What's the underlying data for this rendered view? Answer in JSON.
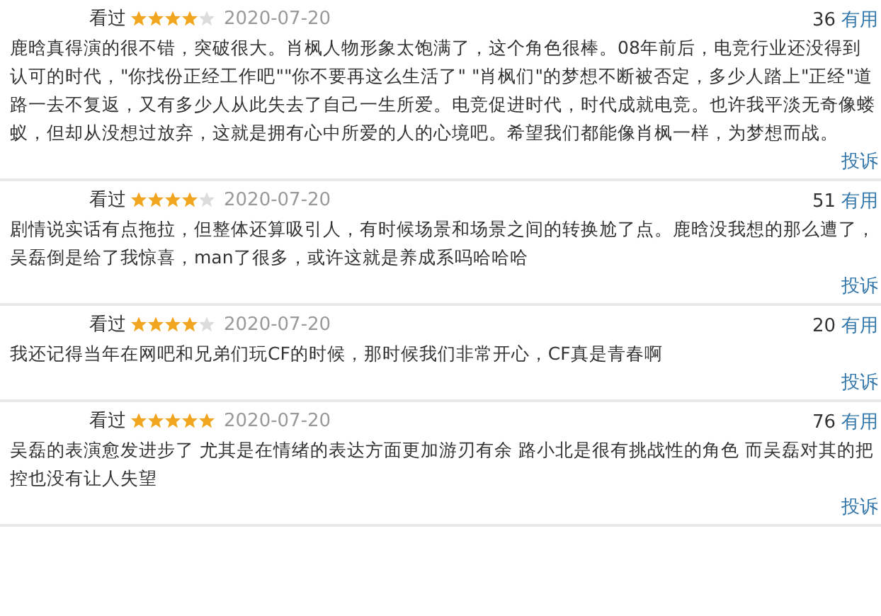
{
  "reviews": [
    {
      "status": "看过",
      "stars": 4,
      "date": "2020-07-20",
      "votes": "36",
      "useful": "有用",
      "text": "鹿晗真得演的很不错，突破很大。肖枫人物形象太饱满了，这个角色很棒。08年前后，电竞行业还没得到认可的时代，\"你找份正经工作吧\"\"你不要再这么生活了\" \"肖枫们\"的梦想不断被否定，多少人踏上\"正经\"道路一去不复返，又有多少人从此失去了自己一生所爱。电竞促进时代，时代成就电竞。也许我平淡无奇像蝼蚁，但却从没想过放弃，这就是拥有心中所爱的人的心境吧。希望我们都能像肖枫一样，为梦想而战。",
      "report": "投诉"
    },
    {
      "status": "看过",
      "stars": 4,
      "date": "2020-07-20",
      "votes": "51",
      "useful": "有用",
      "text": "剧情说实话有点拖拉，但整体还算吸引人，有时候场景和场景之间的转换尬了点。鹿晗没我想的那么遭了，吴磊倒是给了我惊喜，man了很多，或许这就是养成系吗哈哈哈",
      "report": "投诉"
    },
    {
      "status": "看过",
      "stars": 4,
      "date": "2020-07-20",
      "votes": "20",
      "useful": "有用",
      "text": "我还记得当年在网吧和兄弟们玩CF的时候，那时候我们非常开心，CF真是青春啊",
      "report": "投诉"
    },
    {
      "status": "看过",
      "stars": 5,
      "date": "2020-07-20",
      "votes": "76",
      "useful": "有用",
      "text": "吴磊的表演愈发进步了 尤其是在情绪的表达方面更加游刃有余 路小北是很有挑战性的角色 而吴磊对其的把控也没有让人失望",
      "report": "投诉"
    }
  ]
}
